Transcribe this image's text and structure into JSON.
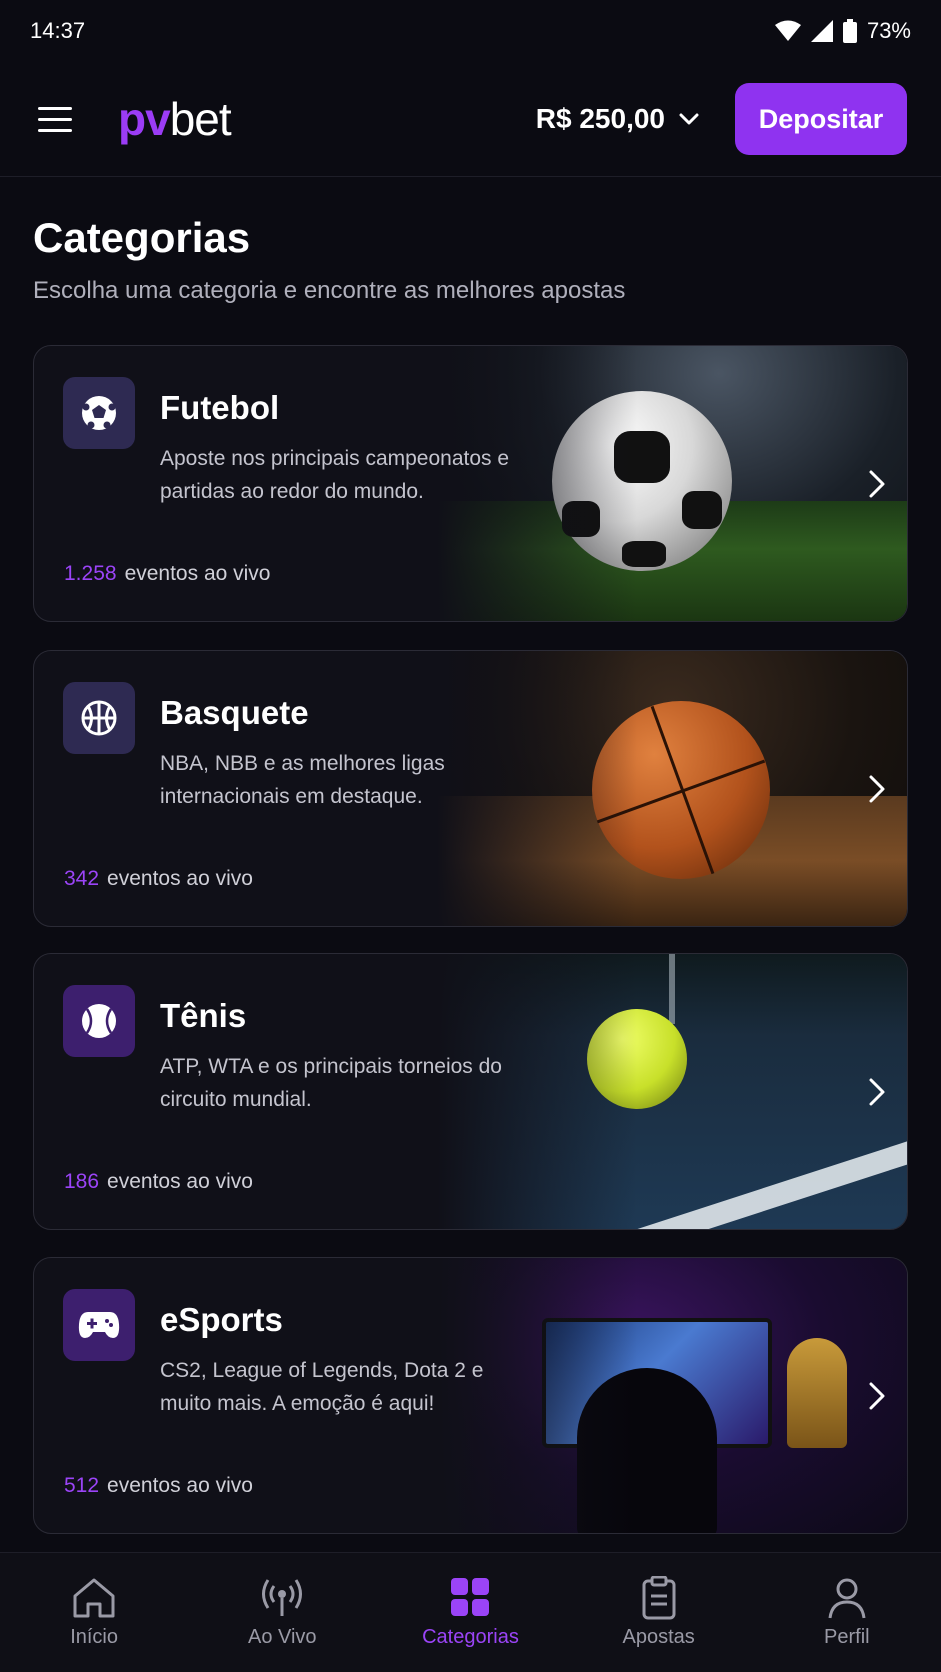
{
  "status_bar": {
    "time": "14:37",
    "battery": "73%",
    "icons": [
      "wifi-icon",
      "signal-icon",
      "battery-icon"
    ]
  },
  "header": {
    "logo_pv": "pv",
    "logo_bet": "bet",
    "balance": "R$ 250,00",
    "deposit_label": "Depositar"
  },
  "page": {
    "title": "Categorias",
    "subtitle": "Escolha uma categoria e encontre as melhores apostas"
  },
  "categories": [
    {
      "name": "Futebol",
      "description": "Aposte nos principais campeonatos e partidas ao redor do mundo.",
      "count": "1.258",
      "count_label": "eventos ao vivo",
      "icon": "soccer-ball-icon"
    },
    {
      "name": "Basquete",
      "description": "NBA, NBB e as melhores ligas internacionais em destaque.",
      "count": "342",
      "count_label": "eventos ao vivo",
      "icon": "basketball-icon"
    },
    {
      "name": "Tênis",
      "description": "ATP, WTA e os principais torneios do circuito mundial.",
      "count": "186",
      "count_label": "eventos ao vivo",
      "icon": "tennis-ball-icon"
    },
    {
      "name": "eSports",
      "description": "CS2, League of Legends, Dota 2 e muito mais. A emoção é aqui!",
      "count": "512",
      "count_label": "eventos ao vivo",
      "icon": "gamepad-icon"
    }
  ],
  "bottom_nav": [
    {
      "label": "Início",
      "icon": "home-icon",
      "active": false
    },
    {
      "label": "Ao Vivo",
      "icon": "broadcast-icon",
      "active": false
    },
    {
      "label": "Categorias",
      "icon": "grid-icon",
      "active": true
    },
    {
      "label": "Apostas",
      "icon": "clipboard-icon",
      "active": false
    },
    {
      "label": "Perfil",
      "icon": "user-icon",
      "active": false
    }
  ],
  "colors": {
    "accent": "#9b44f7",
    "background": "#0b0b12",
    "card": "#101018"
  }
}
